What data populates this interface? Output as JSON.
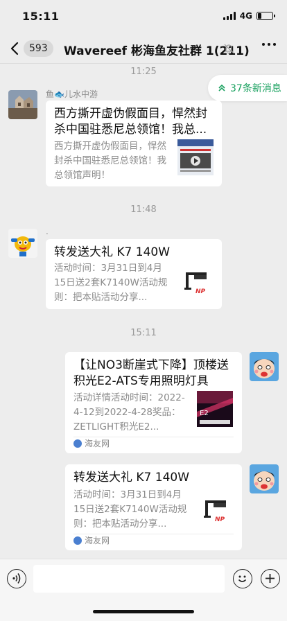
{
  "status_bar": {
    "time": "15:11",
    "network": "4G",
    "battery_level": 0.25
  },
  "nav": {
    "unread_count": "593",
    "title": "Wavereef 彬海鱼友社群 1(211)"
  },
  "new_messages": {
    "label": "37条新消息",
    "color": "#19a15f"
  },
  "messages": [
    {
      "timestamp": "11:25",
      "sender": "鱼🐟儿水中游",
      "card": {
        "title": "西方撕开虚伪假面目，悍然封杀中国驻悉尼总领馆！我总...",
        "desc": "西方撕开虚伪假面目，悍然封杀中国驻悉尼总领馆！我总领馆声明！",
        "thumb_icon": "video-thumbnail"
      }
    },
    {
      "timestamp": "11:48",
      "sender": ".",
      "card": {
        "title": "转发送大礼 K7 140W",
        "desc": "活动时间：3月31日到4月15日送2套K7140W活动规则：把本贴活动分享...",
        "thumb_icon": "aquarium-light-thumbnail",
        "thumb_caption": "NP"
      }
    },
    {
      "timestamp": "15:11",
      "self": true,
      "card": {
        "title": "【让NO3断崖式下降】顶楼送积光E2-ATS专用照明灯具",
        "desc": "活动详情活动时间：2022-4-12到2022-4-28奖品：ZETLIGHT积光E2...",
        "thumb_icon": "zetlight-promo-thumbnail",
        "thumb_caption": "E2",
        "source": "海友网"
      }
    },
    {
      "self": true,
      "card": {
        "title": "转发送大礼 K7 140W",
        "desc": "活动时间：3月31日到4月15日送2套K7140W活动规则：把本贴活动分享...",
        "thumb_icon": "aquarium-light-thumbnail",
        "thumb_caption": "NP",
        "source": "海友网"
      }
    }
  ],
  "input_bar": {
    "placeholder": ""
  }
}
